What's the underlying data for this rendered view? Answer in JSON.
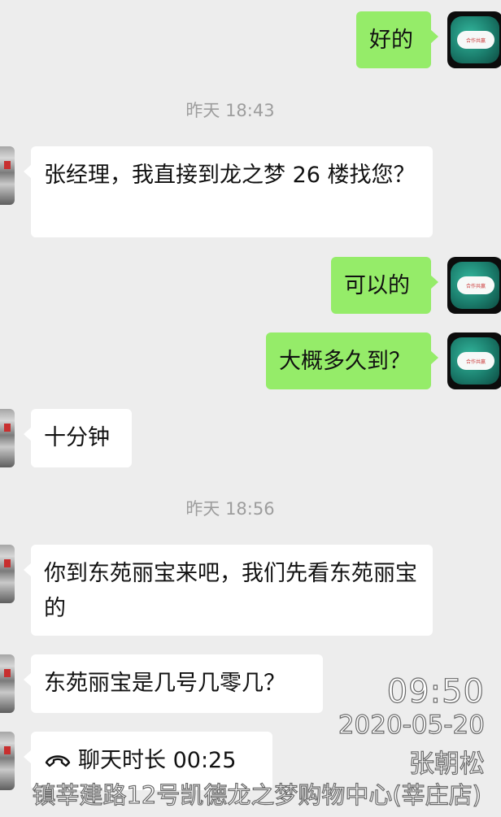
{
  "chat": {
    "messages": [
      {
        "side": "right",
        "text": "好的"
      },
      {
        "side": "left",
        "text": "张经理，我直接到龙之梦 26 楼找您？"
      },
      {
        "side": "right",
        "text": "可以的"
      },
      {
        "side": "right",
        "text": "大概多久到？"
      },
      {
        "side": "left",
        "text": "十分钟"
      },
      {
        "side": "left",
        "text": "你到东苑丽宝来吧，我们先看东苑丽宝的"
      },
      {
        "side": "left",
        "text": "东苑丽宝是几号几零几？"
      }
    ],
    "timestamps": [
      "昨天 18:43",
      "昨天 18:56"
    ],
    "call": {
      "icon": "phone-hangup-icon",
      "label": "聊天时长 00:25"
    }
  },
  "avatar": {
    "me_logo_text": "合作共赢"
  },
  "watermark": {
    "time": "09:50",
    "date": "2020-05-20",
    "name": "张朝松",
    "location": "镇莘建路12号凯德龙之梦购物中心(莘庄店)"
  },
  "colors": {
    "background": "#ededed",
    "bubble_self": "#95ec69",
    "bubble_other": "#ffffff",
    "timestamp": "#9d9d9d"
  }
}
